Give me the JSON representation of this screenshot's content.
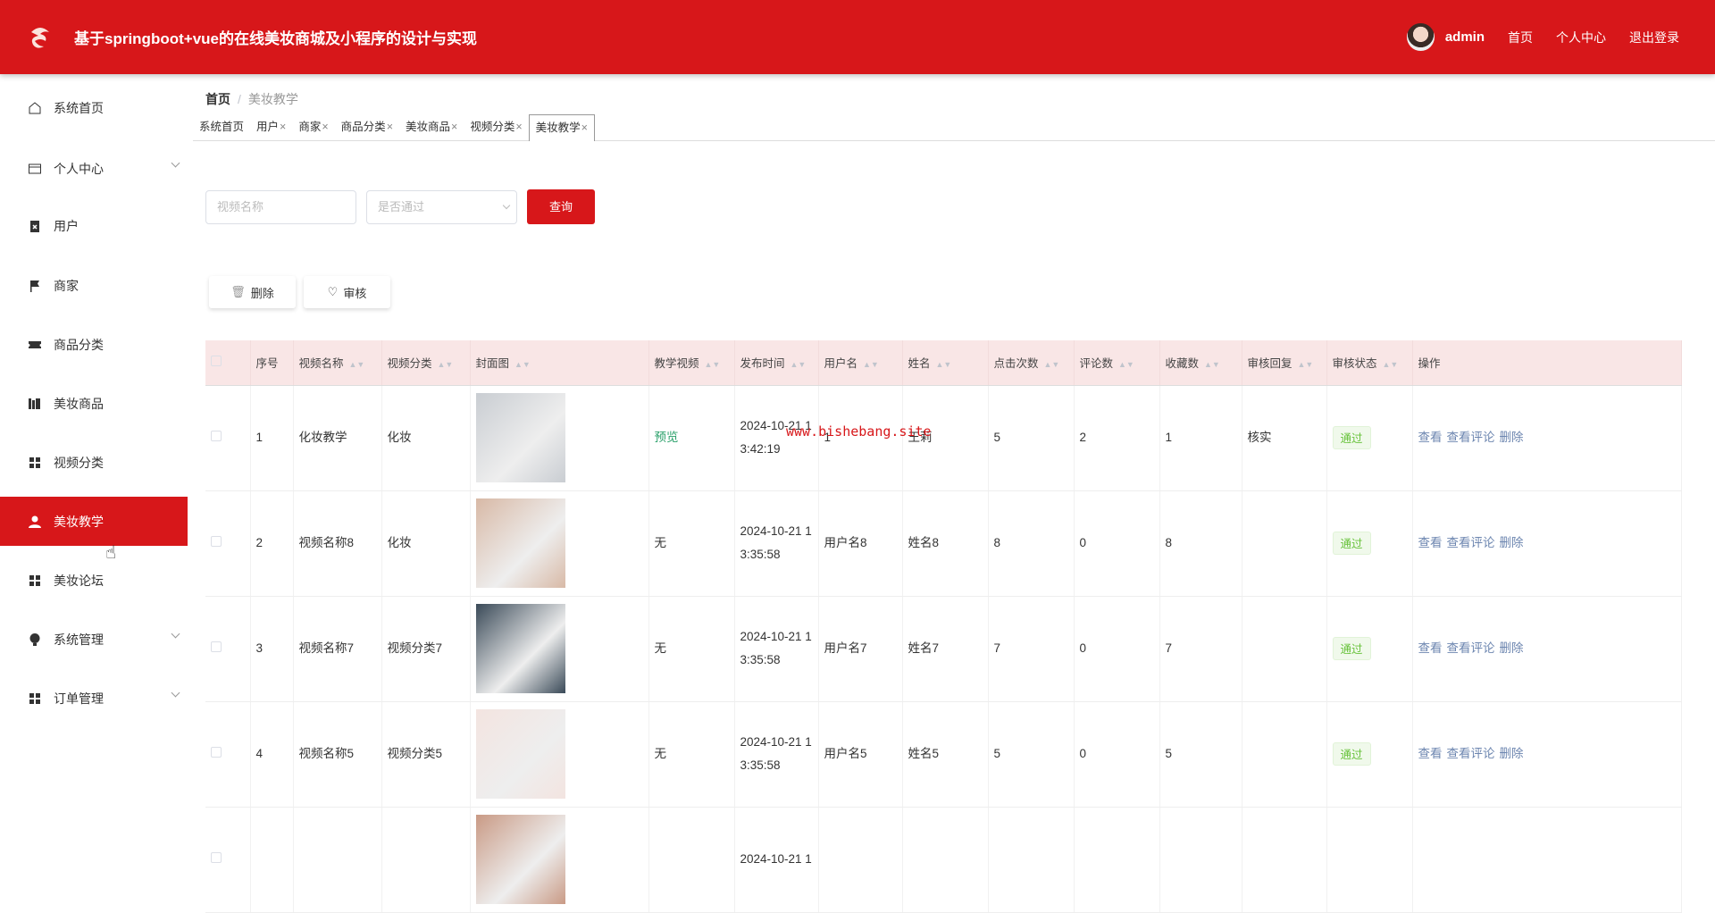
{
  "header": {
    "title": "基于springboot+vue的在线美妆商城及小程序的设计与实现",
    "username": "admin",
    "links": [
      "首页",
      "个人中心",
      "退出登录"
    ]
  },
  "sidebar": {
    "items": [
      {
        "label": "系统首页",
        "icon": "home-icon"
      },
      {
        "label": "个人中心",
        "icon": "wallet-icon",
        "expand": true
      },
      {
        "label": "用户",
        "icon": "clipboard-icon"
      },
      {
        "label": "商家",
        "icon": "flag-icon"
      },
      {
        "label": "商品分类",
        "icon": "ticket-icon"
      },
      {
        "label": "美妆商品",
        "icon": "books-icon"
      },
      {
        "label": "视频分类",
        "icon": "grid-icon"
      },
      {
        "label": "美妆教学",
        "icon": "user-icon",
        "active": true
      },
      {
        "label": "美妆论坛",
        "icon": "grid-icon"
      },
      {
        "label": "系统管理",
        "icon": "bulb-icon",
        "expand": true
      },
      {
        "label": "订单管理",
        "icon": "grid-icon",
        "expand": true
      }
    ]
  },
  "breadcrumb": {
    "home": "首页",
    "current": "美妆教学"
  },
  "tabs": [
    {
      "label": "系统首页",
      "closable": false
    },
    {
      "label": "用户",
      "closable": true
    },
    {
      "label": "商家",
      "closable": true
    },
    {
      "label": "商品分类",
      "closable": true
    },
    {
      "label": "美妆商品",
      "closable": true
    },
    {
      "label": "视频分类",
      "closable": true
    },
    {
      "label": "美妆教学",
      "closable": true,
      "active": true
    }
  ],
  "search": {
    "name_placeholder": "视频名称",
    "status_placeholder": "是否通过",
    "query_label": "查询"
  },
  "actions": {
    "delete_label": "删除",
    "audit_label": "审核"
  },
  "table": {
    "columns": [
      "",
      "序号",
      "视频名称",
      "视频分类",
      "封面图",
      "教学视频",
      "发布时间",
      "用户名",
      "姓名",
      "点击次数",
      "评论数",
      "收藏数",
      "审核回复",
      "审核状态",
      "操作"
    ],
    "ops": [
      "查看",
      "查看评论",
      "删除"
    ],
    "rows": [
      {
        "index": "1",
        "name": "化妆教学",
        "category": "化妆",
        "video": "预览",
        "time": "2024-10-21 13:42:19",
        "username": "1",
        "realname": "王莉",
        "clicks": "5",
        "comments": "2",
        "favorites": "1",
        "reply": "核实",
        "status": "通过",
        "cover": "#c9cdd2"
      },
      {
        "index": "2",
        "name": "视频名称8",
        "category": "化妆",
        "video": "无",
        "time": "2024-10-21 13:35:58",
        "username": "用户名8",
        "realname": "姓名8",
        "clicks": "8",
        "comments": "0",
        "favorites": "8",
        "reply": "",
        "status": "通过",
        "cover": "#d8b9a6"
      },
      {
        "index": "3",
        "name": "视频名称7",
        "category": "视频分类7",
        "video": "无",
        "time": "2024-10-21 13:35:58",
        "username": "用户名7",
        "realname": "姓名7",
        "clicks": "7",
        "comments": "0",
        "favorites": "7",
        "reply": "",
        "status": "通过",
        "cover": "#3a4a58"
      },
      {
        "index": "4",
        "name": "视频名称5",
        "category": "视频分类5",
        "video": "无",
        "time": "2024-10-21 13:35:58",
        "username": "用户名5",
        "realname": "姓名5",
        "clicks": "5",
        "comments": "0",
        "favorites": "5",
        "reply": "",
        "status": "通过",
        "cover": "#f3e4e0"
      },
      {
        "index": "",
        "name": "",
        "category": "",
        "video": "",
        "time": "2024-10-21 1",
        "username": "",
        "realname": "",
        "clicks": "",
        "comments": "",
        "favorites": "",
        "reply": "",
        "status": "",
        "cover": "#c99a85"
      }
    ]
  },
  "watermark": "www.bishebang.site",
  "colors": {
    "brand": "#d7171a",
    "header_bg": "#f9e6e6",
    "pass_tag": "#67c23a"
  }
}
